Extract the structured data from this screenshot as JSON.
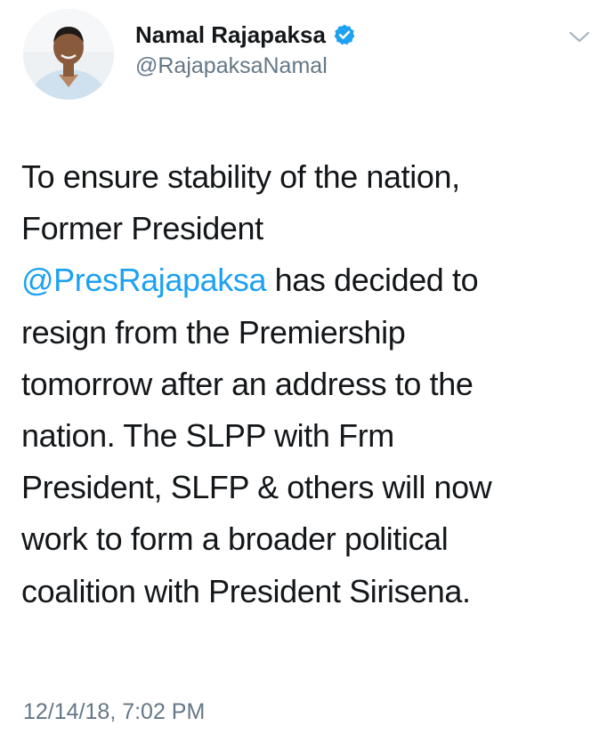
{
  "tweet": {
    "author": {
      "display_name": "Namal Rajapaksa",
      "handle": "@RajapaksaNamal",
      "verified": true,
      "avatar_icon": "profile-photo"
    },
    "menu_icon": "chevron-down-icon",
    "text_lines": [
      {
        "before": "To ensure stability of the nation,",
        "mention": "",
        "after": ""
      },
      {
        "before": "Former President",
        "mention": "",
        "after": ""
      },
      {
        "before": "",
        "mention": "@PresRajapaksa",
        "after": " has decided to"
      },
      {
        "before": "resign from the Premiership",
        "mention": "",
        "after": ""
      },
      {
        "before": "tomorrow after an address to the",
        "mention": "",
        "after": ""
      },
      {
        "before": "nation. The SLPP with Frm",
        "mention": "",
        "after": ""
      },
      {
        "before": "President, SLFP & others will now",
        "mention": "",
        "after": ""
      },
      {
        "before": "work to form a broader political",
        "mention": "",
        "after": ""
      },
      {
        "before": "coalition with President Sirisena.",
        "mention": "",
        "after": ""
      }
    ],
    "timestamp": "12/14/18, 7:02 PM"
  },
  "colors": {
    "text": "#14171a",
    "secondary": "#657786",
    "link": "#1da1f2",
    "verified_badge": "#1da1f2"
  }
}
